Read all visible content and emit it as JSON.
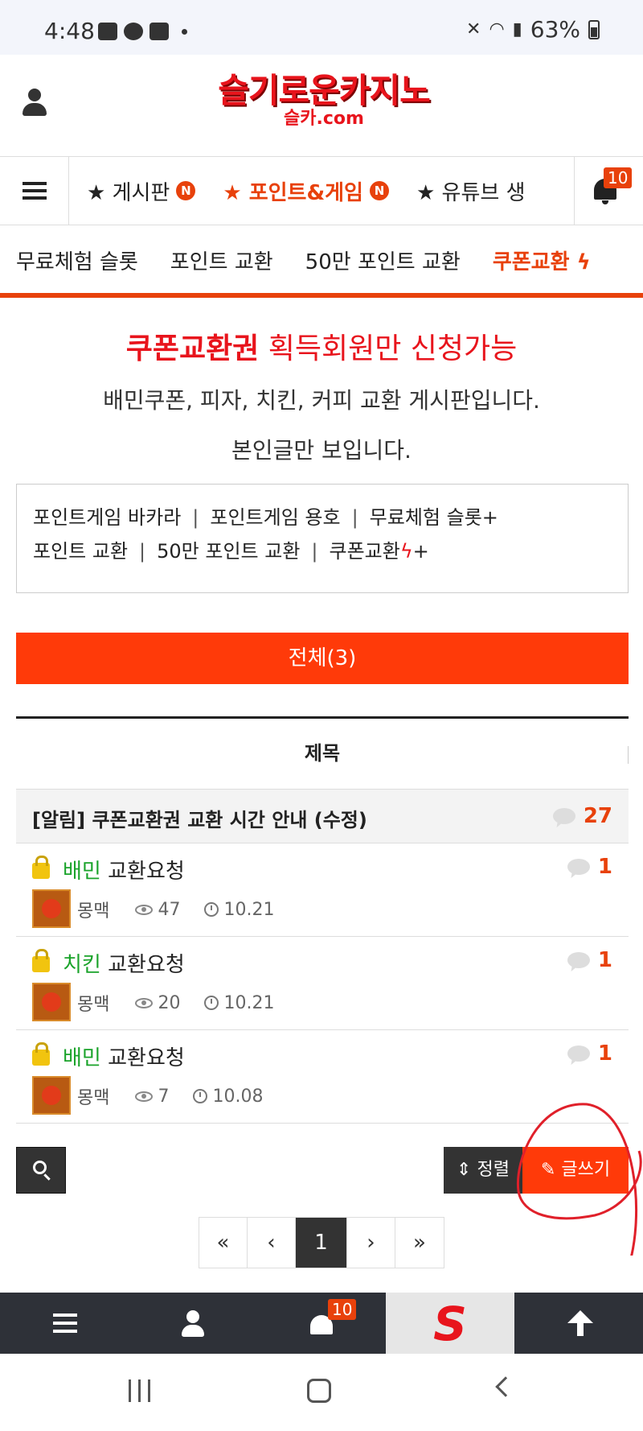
{
  "status": {
    "time": "4:48",
    "battery": "63%"
  },
  "header": {
    "logo": "슬기로운카지노",
    "logo_sub": "슬카.com"
  },
  "nav": {
    "items": [
      {
        "label": "★ 게시판",
        "badge": "N"
      },
      {
        "label": "★ 포인트&게임",
        "badge": "N"
      },
      {
        "label": "★ 유튜브 생"
      }
    ],
    "notification_count": "10"
  },
  "subnav": {
    "items": [
      "무료체험 슬롯",
      "포인트 교환",
      "50만 포인트 교환",
      "쿠폰교환"
    ]
  },
  "intro": {
    "title_strong": "쿠폰교환권",
    "title_rest": " 획득회원만 신청가능",
    "line1": "배민쿠폰, 피자, 치킨, 커피 교환 게시판입니다.",
    "line2": "본인글만 보입니다."
  },
  "quicklinks": {
    "row1": [
      "포인트게임 바카라",
      "포인트게임 용호",
      "무료체험 슬롯+"
    ],
    "row2": [
      "포인트 교환",
      "50만 포인트 교환",
      "쿠폰교환",
      "+"
    ],
    "separator": "|"
  },
  "all_button": "전체(3)",
  "table": {
    "header": "제목",
    "notice": {
      "title": "[알림] 쿠폰교환권 교환 시간 안내 (수정)",
      "comments": "27"
    },
    "rows": [
      {
        "category": "배민",
        "title": " 교환요청",
        "author": "몽맥",
        "views": "47",
        "date": "10.21",
        "comments": "1"
      },
      {
        "category": "치킨",
        "title": " 교환요청",
        "author": "몽맥",
        "views": "20",
        "date": "10.21",
        "comments": "1"
      },
      {
        "category": "배민",
        "title": " 교환요청",
        "author": "몽맥",
        "views": "7",
        "date": "10.08",
        "comments": "1"
      }
    ]
  },
  "actions": {
    "sort": "정렬",
    "write": "글쓰기"
  },
  "pager": {
    "first": "«",
    "prev": "‹",
    "current": "1",
    "next": "›",
    "last": "»"
  },
  "bottombar": {
    "notification_count": "10",
    "logo_letter": "S"
  },
  "colors": {
    "accent": "#ff3a09",
    "brand_red": "#e8141c",
    "category_green": "#1aa32a"
  }
}
